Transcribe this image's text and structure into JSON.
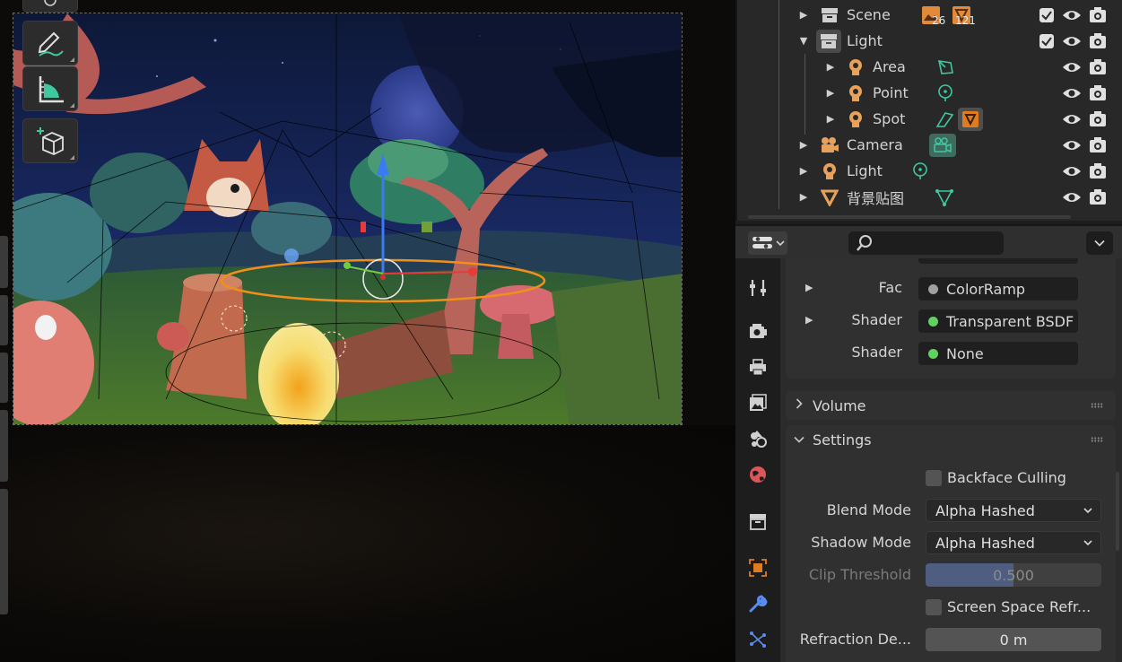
{
  "outliner": {
    "rows": [
      {
        "name": "Scene",
        "badges": [
          "26",
          "121"
        ]
      },
      {
        "name": "Light"
      },
      {
        "name": "Area"
      },
      {
        "name": "Point"
      },
      {
        "name": "Spot"
      },
      {
        "name": "Camera"
      },
      {
        "name": "Light"
      },
      {
        "name": "背景贴图"
      }
    ]
  },
  "properties": {
    "inputs": [
      {
        "label": "Fac",
        "value": "ColorRamp",
        "dot": "#a0a0a0"
      },
      {
        "label": "Shader",
        "value": "Transparent BSDF",
        "dot": "#5ed35e"
      },
      {
        "label": "Shader",
        "value": "None",
        "dot": "#5ed35e"
      }
    ],
    "volume_label": "Volume",
    "settings_label": "Settings",
    "backface_culling": "Backface Culling",
    "blend_mode_label": "Blend Mode",
    "blend_mode_value": "Alpha Hashed",
    "shadow_mode_label": "Shadow Mode",
    "shadow_mode_value": "Alpha Hashed",
    "clip_threshold_label": "Clip Threshold",
    "clip_threshold_value": "0.500",
    "clip_threshold_fraction": 0.5,
    "screen_space_refraction": "Screen Space Refr...",
    "refraction_depth_label": "Refraction De...",
    "refraction_depth_value": "0 m"
  },
  "colors": {
    "accent": "#e07c1f",
    "socket_green": "#5ed35e",
    "light_icon": "#e8a15a",
    "object_data": "#3fc7a0",
    "slider_fill": "#4f5e80"
  }
}
